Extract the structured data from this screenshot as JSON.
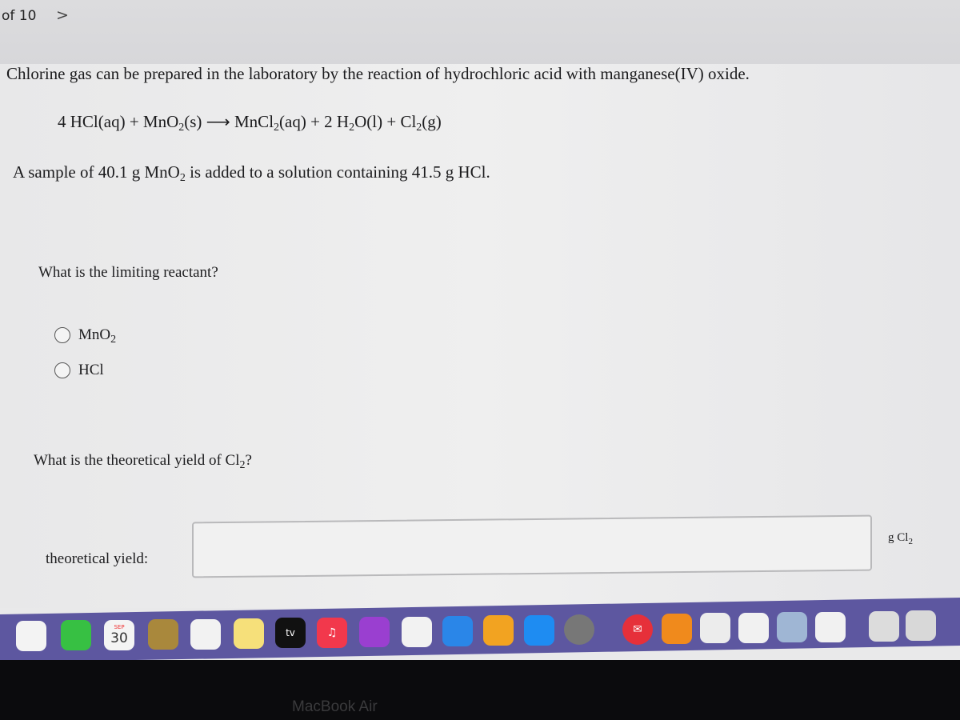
{
  "nav": {
    "pager": "of 10",
    "next": ">"
  },
  "problem": {
    "intro": "Chlorine gas can be prepared in the laboratory by the reaction of hydrochloric acid with manganese(IV) oxide.",
    "equation": {
      "a": "4 HCl(aq) + MnO",
      "b": "(s) ⟶ MnCl",
      "c": "(aq) + 2 H",
      "d": "O(l) + Cl",
      "e": "(g)",
      "sub": "2"
    },
    "sample": {
      "a": "A sample of 40.1 g MnO",
      "b": " is added to a solution containing 41.5 g HCl.",
      "sub": "2"
    }
  },
  "q1": {
    "question": "What is the limiting reactant?",
    "options": [
      {
        "label": "MnO",
        "sub": "2"
      },
      {
        "label": "HCl"
      }
    ]
  },
  "q2": {
    "question_a": "What is the theoretical yield of Cl",
    "question_b": "?",
    "sub": "2",
    "field_label": "theoretical yield:",
    "value": "",
    "unit_a": "g Cl",
    "unit_sub": "2"
  },
  "dock": {
    "calendar_month": "SEP",
    "calendar_day": "30",
    "tv_label": "tv",
    "icons": [
      {
        "name": "photos",
        "color": "#f3f3f3"
      },
      {
        "name": "facetime",
        "color": "#37c043"
      },
      {
        "name": "calendar",
        "color": "#f4f4f4"
      },
      {
        "name": "contacts",
        "color": "#a9883c"
      },
      {
        "name": "reminders",
        "color": "#f2f2f2"
      },
      {
        "name": "notes",
        "color": "#f6e07a"
      },
      {
        "name": "apple-tv",
        "color": "#111111"
      },
      {
        "name": "music",
        "color": "#f2384c"
      },
      {
        "name": "podcasts",
        "color": "#9a3fd0"
      },
      {
        "name": "news",
        "color": "#f2f2f2"
      },
      {
        "name": "keynote",
        "color": "#2a86e8"
      },
      {
        "name": "pages",
        "color": "#f2a321"
      },
      {
        "name": "app-store",
        "color": "#1e8cf2"
      },
      {
        "name": "system-preferences",
        "color": "#777777"
      },
      {
        "name": "mail",
        "color": "#e6303a"
      },
      {
        "name": "books",
        "color": "#f08a1c"
      },
      {
        "name": "powerpoint",
        "color": "#ececec"
      },
      {
        "name": "word",
        "color": "#f1f1f1"
      },
      {
        "name": "preview",
        "color": "#9fb6d4"
      },
      {
        "name": "outlook",
        "color": "#f1f1f1"
      },
      {
        "name": "downloads",
        "color": "#dcdcdc"
      },
      {
        "name": "trash",
        "color": "#d8d8d8"
      }
    ]
  },
  "bezel": {
    "label": "MacBook Air"
  }
}
